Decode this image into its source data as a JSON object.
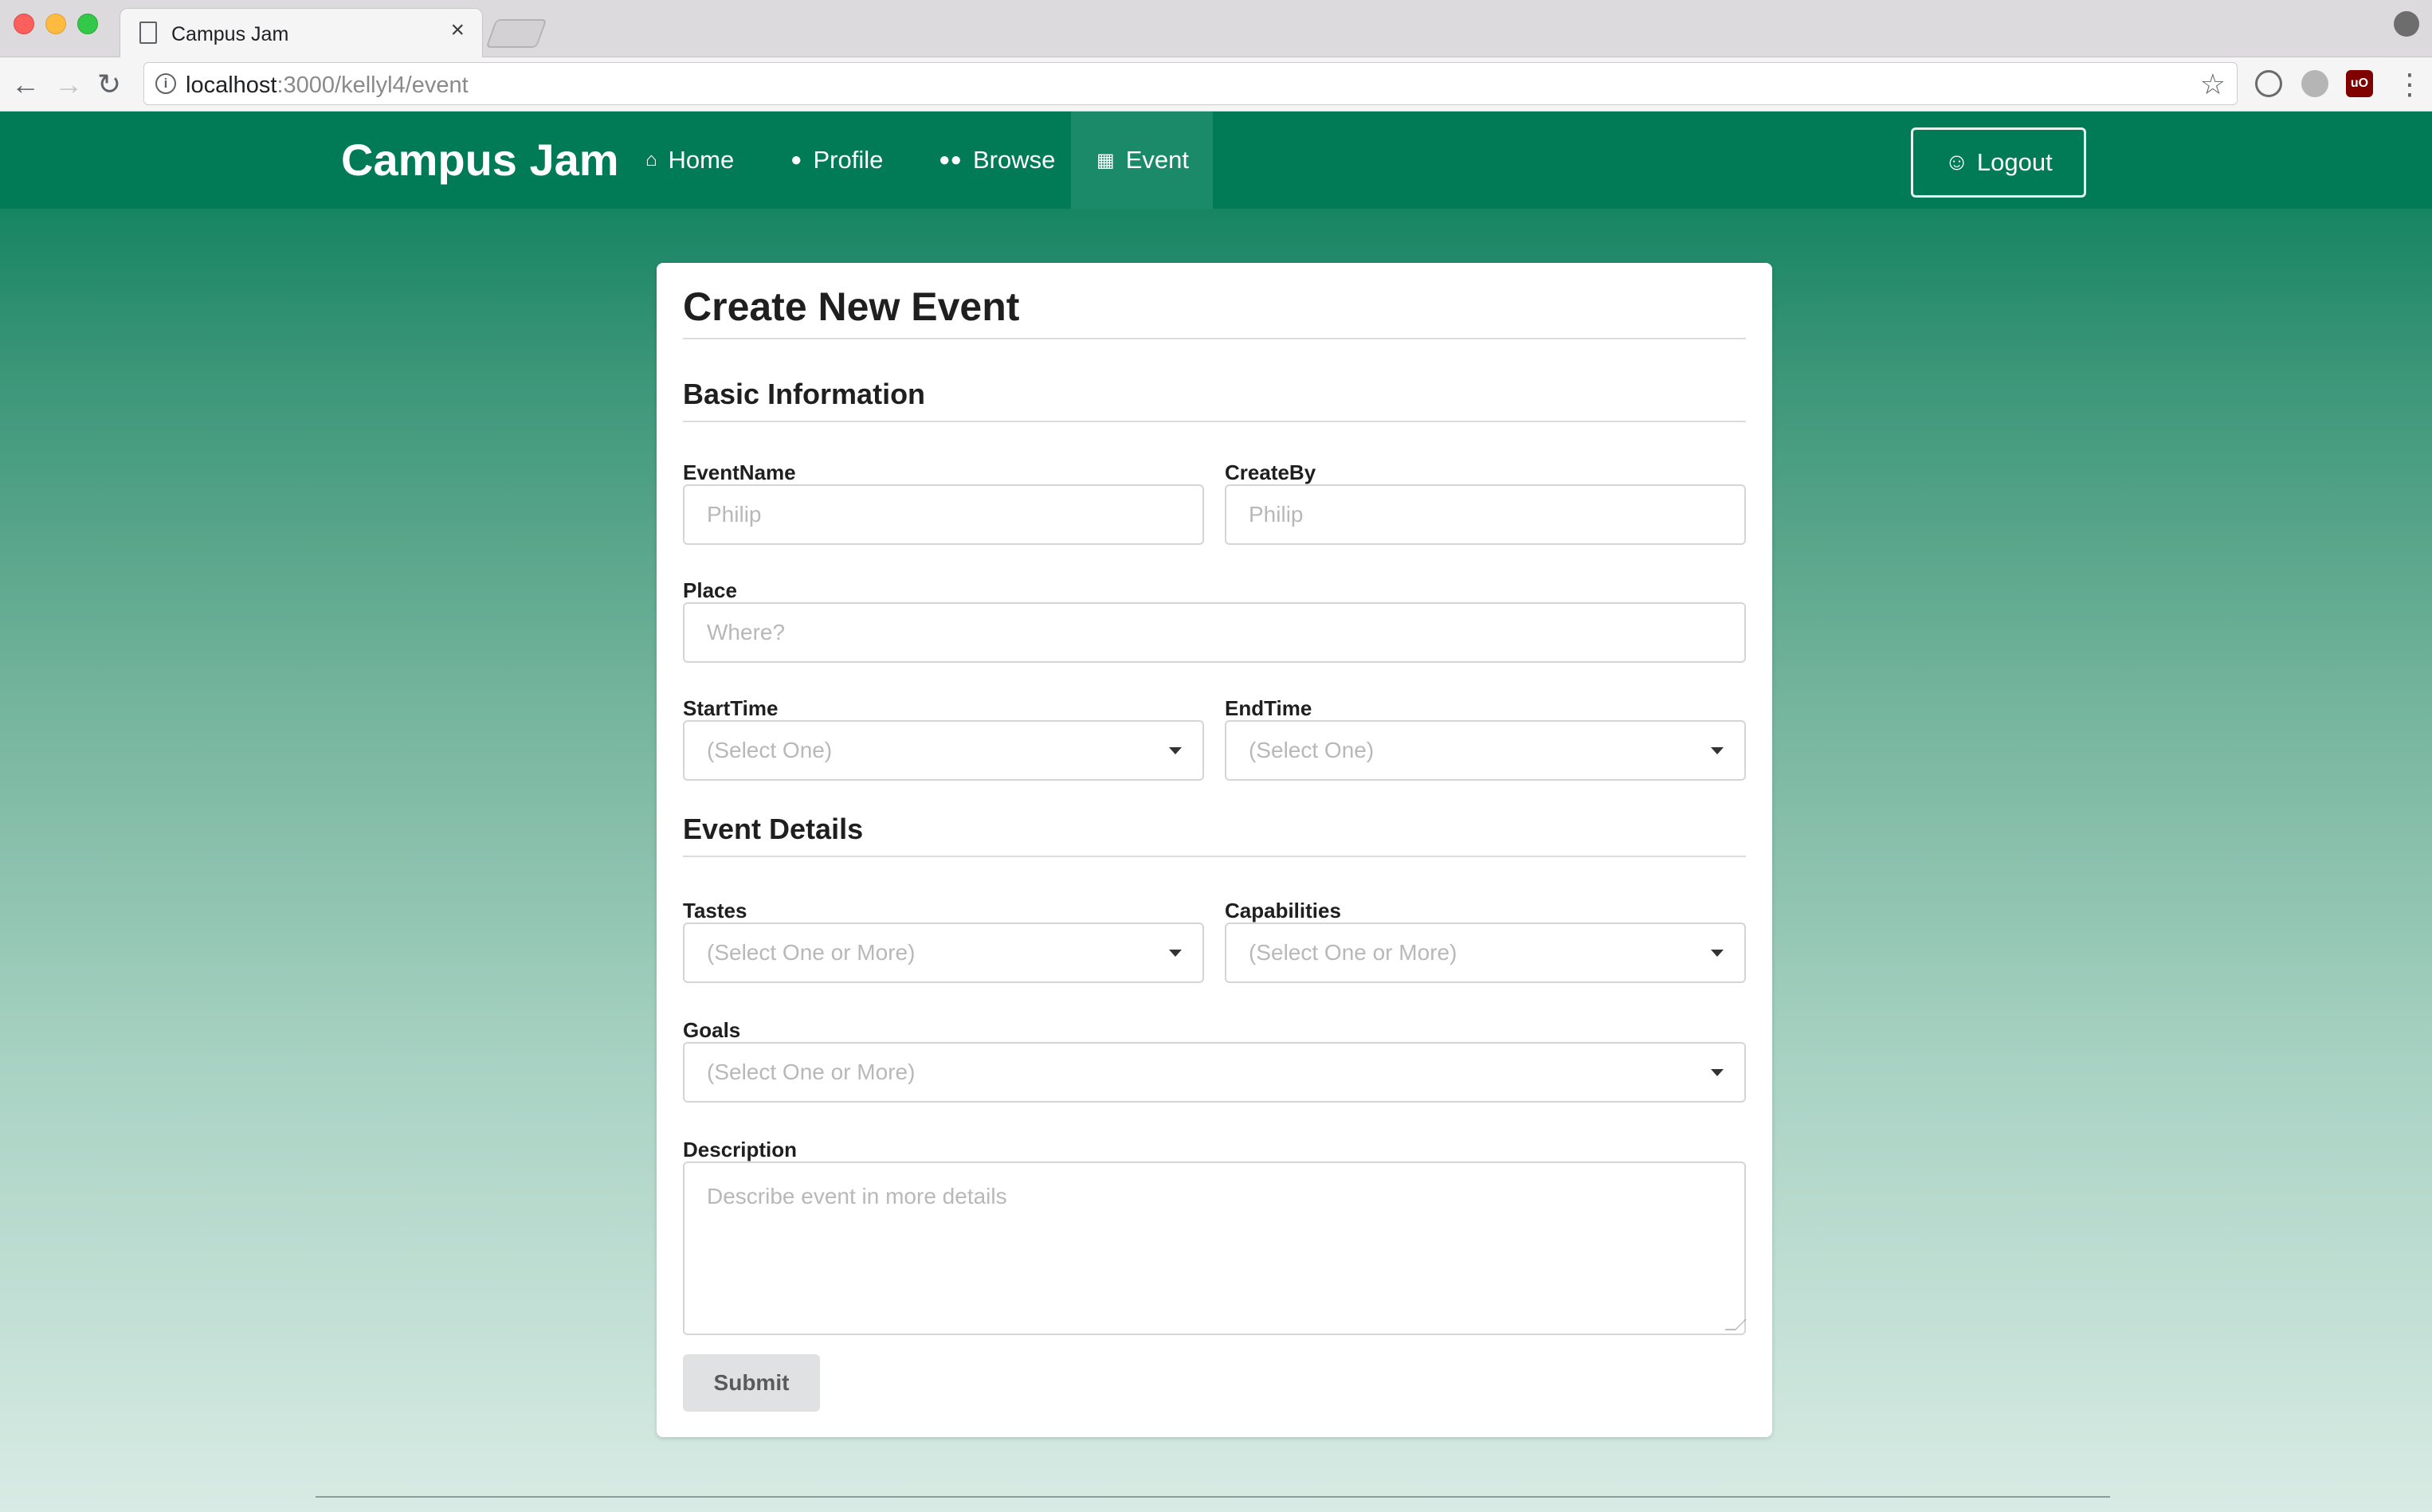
{
  "browser": {
    "tab_title": "Campus Jam",
    "tab_close": "×",
    "url_host": "localhost",
    "url_path": ":3000/kellyl4/event",
    "back_glyph": "←",
    "forward_glyph": "→",
    "reload_glyph": "↻",
    "star_glyph": "☆",
    "menu_glyph": "⋮",
    "info_glyph": "i",
    "ublock_label": "uO"
  },
  "navbar": {
    "brand": "Campus Jam",
    "items": [
      {
        "label": "Home",
        "icon": "home-icon",
        "glyph": "⌂"
      },
      {
        "label": "Profile",
        "icon": "user-icon",
        "glyph": "●"
      },
      {
        "label": "Browse",
        "icon": "users-icon",
        "glyph": "●●"
      },
      {
        "label": "Event",
        "icon": "calendar-icon",
        "glyph": "▦",
        "active": true
      }
    ],
    "logout_label": "Logout",
    "logout_icon_glyph": "☺"
  },
  "form": {
    "title": "Create New Event",
    "basic_section": "Basic Information",
    "details_section": "Event Details",
    "event_name": {
      "label": "EventName",
      "placeholder": "Philip"
    },
    "create_by": {
      "label": "CreateBy",
      "placeholder": "Philip"
    },
    "place": {
      "label": "Place",
      "placeholder": "Where?"
    },
    "start_time": {
      "label": "StartTime",
      "placeholder": "(Select One)"
    },
    "end_time": {
      "label": "EndTime",
      "placeholder": "(Select One)"
    },
    "tastes": {
      "label": "Tastes",
      "placeholder": "(Select One or More)"
    },
    "capabilities": {
      "label": "Capabilities",
      "placeholder": "(Select One or More)"
    },
    "goals": {
      "label": "Goals",
      "placeholder": "(Select One or More)"
    },
    "description": {
      "label": "Description",
      "placeholder": "Describe event in more details"
    },
    "submit_label": "Submit"
  },
  "colors": {
    "brand_green": "#017b55",
    "active_nav": "#1b8a68",
    "button_gray": "#e0e1e2"
  }
}
